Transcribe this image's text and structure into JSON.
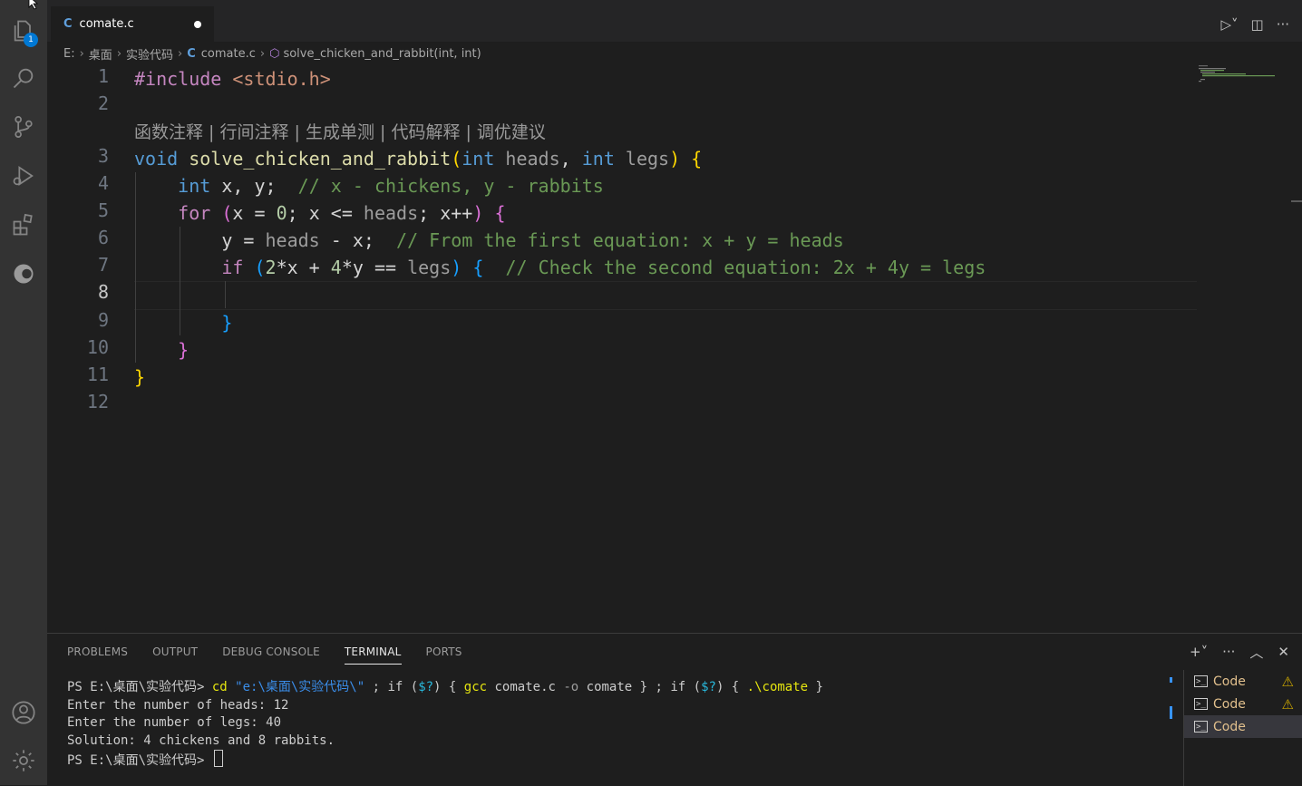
{
  "tab": {
    "icon_letter": "C",
    "filename": "comate.c"
  },
  "breadcrumb": [
    "E:",
    "桌面",
    "实验代码",
    "comate.c",
    "solve_chicken_and_rabbit(int, int)"
  ],
  "activity": {
    "explorer_badge": "1"
  },
  "code_lens": "函数注释 | 行间注释 | 生成单测 | 代码解释 | 调优建议",
  "line_numbers": [
    "1",
    "2",
    "3",
    "4",
    "5",
    "6",
    "7",
    "8",
    "9",
    "10",
    "11",
    "12"
  ],
  "code": {
    "l1_pp": "#include",
    "l1_hdr": "<stdio.h>",
    "l3_void": "void",
    "l3_fn": "solve_chicken_and_rabbit",
    "l3_int1": "int",
    "l3_p1": "heads",
    "l3_int2": "int",
    "l3_p2": "legs",
    "l4_int": "int",
    "l4_vars": "x, y;",
    "l4_cm": "// x - chickens, y - rabbits",
    "l5_for": "for",
    "l5_a": "x = ",
    "l5_zero": "0",
    "l5_b": "; x <= ",
    "l5_heads": "heads",
    "l5_c": "; x++",
    "l6_a": "y = ",
    "l6_heads": "heads",
    "l6_b": " - x;",
    "l6_cm": "// From the first equation: x + y = heads",
    "l7_if": "if",
    "l7_two": "2",
    "l7_a": "*x + ",
    "l7_four": "4",
    "l7_b": "*y == ",
    "l7_legs": "legs",
    "l7_cm": "// Check the second equation: 2x + 4y = legs"
  },
  "panel": {
    "tabs": [
      "PROBLEMS",
      "OUTPUT",
      "DEBUG CONSOLE",
      "TERMINAL",
      "PORTS"
    ],
    "active_tab": "TERMINAL"
  },
  "terminal": {
    "prompt": "PS E:\\桌面\\实验代码> ",
    "cmd_cd": "cd",
    "cmd_path": "\"e:\\桌面\\实验代码\\\"",
    "cmd_rest1": " ; if (",
    "cmd_q": "$?",
    "cmd_rest2": ") { ",
    "cmd_gcc": "gcc",
    "cmd_gcc_args1": " comate.c ",
    "cmd_flag": "-o",
    "cmd_gcc_args2": " comate } ; if (",
    "cmd_q2": "$?",
    "cmd_rest3": ") { ",
    "cmd_run": ".\\comate",
    "cmd_end": " }",
    "out1": "Enter the number of heads: 12",
    "out2": "Enter the number of legs: 40",
    "out3": "Solution: 4 chickens and 8 rabbits.",
    "prompt2": "PS E:\\桌面\\实验代码> "
  },
  "terminal_list": [
    "Code",
    "Code",
    "Code"
  ]
}
